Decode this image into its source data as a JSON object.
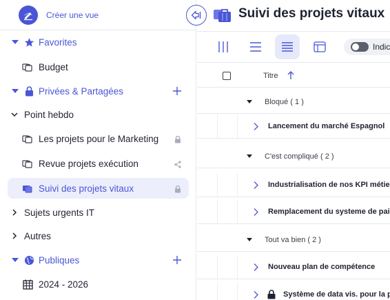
{
  "sidebar": {
    "create_label": "Créer une vue",
    "favorites": {
      "label": "Favorites",
      "items": [
        {
          "label": "Budget"
        }
      ]
    },
    "private": {
      "label": "Privées & Partagées",
      "groups": {
        "point_hebdo": {
          "label": "Point hebdo",
          "items": [
            {
              "label": "Les projets pour le Marketing"
            },
            {
              "label": "Revue projets exécution"
            },
            {
              "label": "Suivi des projets vitaux"
            }
          ]
        },
        "sujets_urgents": {
          "label": "Sujets urgents IT"
        },
        "autres": {
          "label": "Autres"
        }
      }
    },
    "public": {
      "label": "Publiques",
      "items": [
        {
          "label": "2024 - 2026"
        }
      ]
    }
  },
  "main": {
    "title": "Suivi des projets vitaux",
    "toggle_label": "Indicateurs",
    "header": {
      "title_col": "Titre"
    },
    "groups": [
      {
        "label": "Bloqué ( 1 )",
        "rows": [
          {
            "label": "Lancement du marché Espagnol"
          }
        ]
      },
      {
        "label": "C'est compliqué ( 2 )",
        "rows": [
          {
            "label": "Industrialisation de nos KPI métier"
          },
          {
            "label": "Remplacement du systeme de paie"
          }
        ]
      },
      {
        "label": "Tout va bien ( 2 )",
        "rows": [
          {
            "label": "Nouveau plan de compétence"
          },
          {
            "label": "Système de data vis. pour la production"
          }
        ]
      }
    ]
  },
  "colors": {
    "accent": "#4a56d6",
    "selected_bg": "#eceefb",
    "text": "#1f2230",
    "border": "#e6e8ee"
  },
  "icons": [
    "pencil-icon",
    "collapse-left-icon",
    "star-icon",
    "lock-icon",
    "globe-icon",
    "plus-icon",
    "briefcase-icon",
    "share-icon",
    "calendar-icon",
    "chevron-right-icon",
    "chevron-down-icon",
    "columns-icon",
    "list-icon",
    "compact-list-icon",
    "board-icon",
    "sort-up-icon"
  ]
}
